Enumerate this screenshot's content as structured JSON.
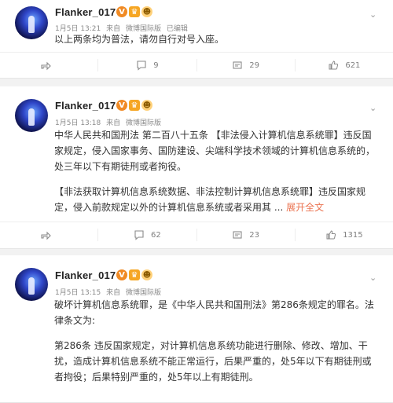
{
  "posts": [
    {
      "user": "Flanker_017",
      "time": "1月5日 13:21",
      "from": "来自",
      "source": "微博国际版",
      "edited": "已编辑",
      "paragraphs": [
        "以上两条均为普法，请勿自行对号入座。"
      ],
      "expand": "",
      "actions": {
        "share": "",
        "comment": "9",
        "like": "29",
        "view": "621"
      }
    },
    {
      "user": "Flanker_017",
      "time": "1月5日 13:18",
      "from": "来自",
      "source": "微博国际版",
      "edited": "",
      "paragraphs": [
        "中华人民共和国刑法 第二百八十五条   【非法侵入计算机信息系统罪】违反国家规定，侵入国家事务、国防建设、尖端科学技术领域的计算机信息系统的，处三年以下有期徒刑或者拘役。",
        "【非法获取计算机信息系统数据、非法控制计算机信息系统罪】违反国家规定，侵入前款规定以外的计算机信息系统或者采用其 ..."
      ],
      "expand": "展开全文",
      "actions": {
        "share": "",
        "comment": "62",
        "like": "23",
        "view": "1315"
      }
    },
    {
      "user": "Flanker_017",
      "time": "1月5日 13:15",
      "from": "来自",
      "source": "微博国际版",
      "edited": "",
      "paragraphs": [
        "破坏计算机信息系统罪，是《中华人民共和国刑法》第286条规定的罪名。法律条文为:",
        "第286条 违反国家规定，对计算机信息系统功能进行删除、修改、增加、干扰，造成计算机信息系统不能正常运行，后果严重的，处5年以下有期徒刑或者拘役；后果特别严重的，处5年以上有期徒刑。"
      ],
      "expand": "",
      "actions": {}
    }
  ],
  "badge_glyphs": {
    "v": "V",
    "vip": "♛",
    "face": "☻"
  },
  "colors": {
    "link": "#eb7350",
    "badge_v": "#f08a24"
  }
}
